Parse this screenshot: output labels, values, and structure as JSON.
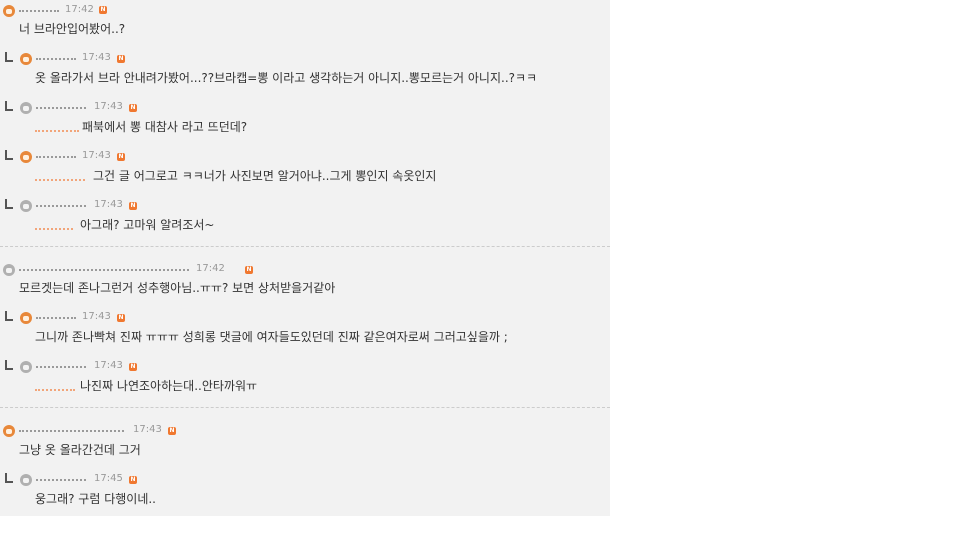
{
  "comments": [
    {
      "time": "17:42",
      "text": "너 브라안입어봤어..?"
    },
    {
      "time": "17:43",
      "text": "옷 올라가서 브라 안내려가봤어...??브라캡=뽕 이라고 생각하는거 아니지..뽕모르는거 아니지..?ㅋㅋ"
    },
    {
      "time": "17:43",
      "text": "패북에서 뽕 대참사 라고 뜨던데?"
    },
    {
      "time": "17:43",
      "text": "그건 글 어그로고 ㅋㅋ너가 사진보면 알거아냐..그게 뽕인지 속옷인지"
    },
    {
      "time": "17:43",
      "text": "아그래? 고마워 알려조서~"
    },
    {
      "time": "17:42",
      "text": "모르겟는데 존나그런거 성추행아님..ㅠㅠ? 보면 상처받을거같아"
    },
    {
      "time": "17:43",
      "text": "그니까 존나빡쳐 진짜 ㅠㅠㅠ 성희롱 댓글에 여자들도있던데 진짜 같은여자로써 그러고싶을까 ;"
    },
    {
      "time": "17:43",
      "text": "나진짜 나연조아하는대..안타까워ㅠ"
    },
    {
      "time": "17:43",
      "text": "그냥 옷 올라간건데 그거"
    },
    {
      "time": "17:45",
      "text": "웅그래? 구럼 다행이네.."
    }
  ],
  "badge_letter": "N",
  "icons": {
    "avatar": "user-avatar-icon",
    "reply": "reply-arrow-icon",
    "badge": "new-badge-icon"
  },
  "colors": {
    "panel": "#f2f2f2",
    "badge": "#f07830",
    "time": "#999999",
    "text": "#333333"
  }
}
